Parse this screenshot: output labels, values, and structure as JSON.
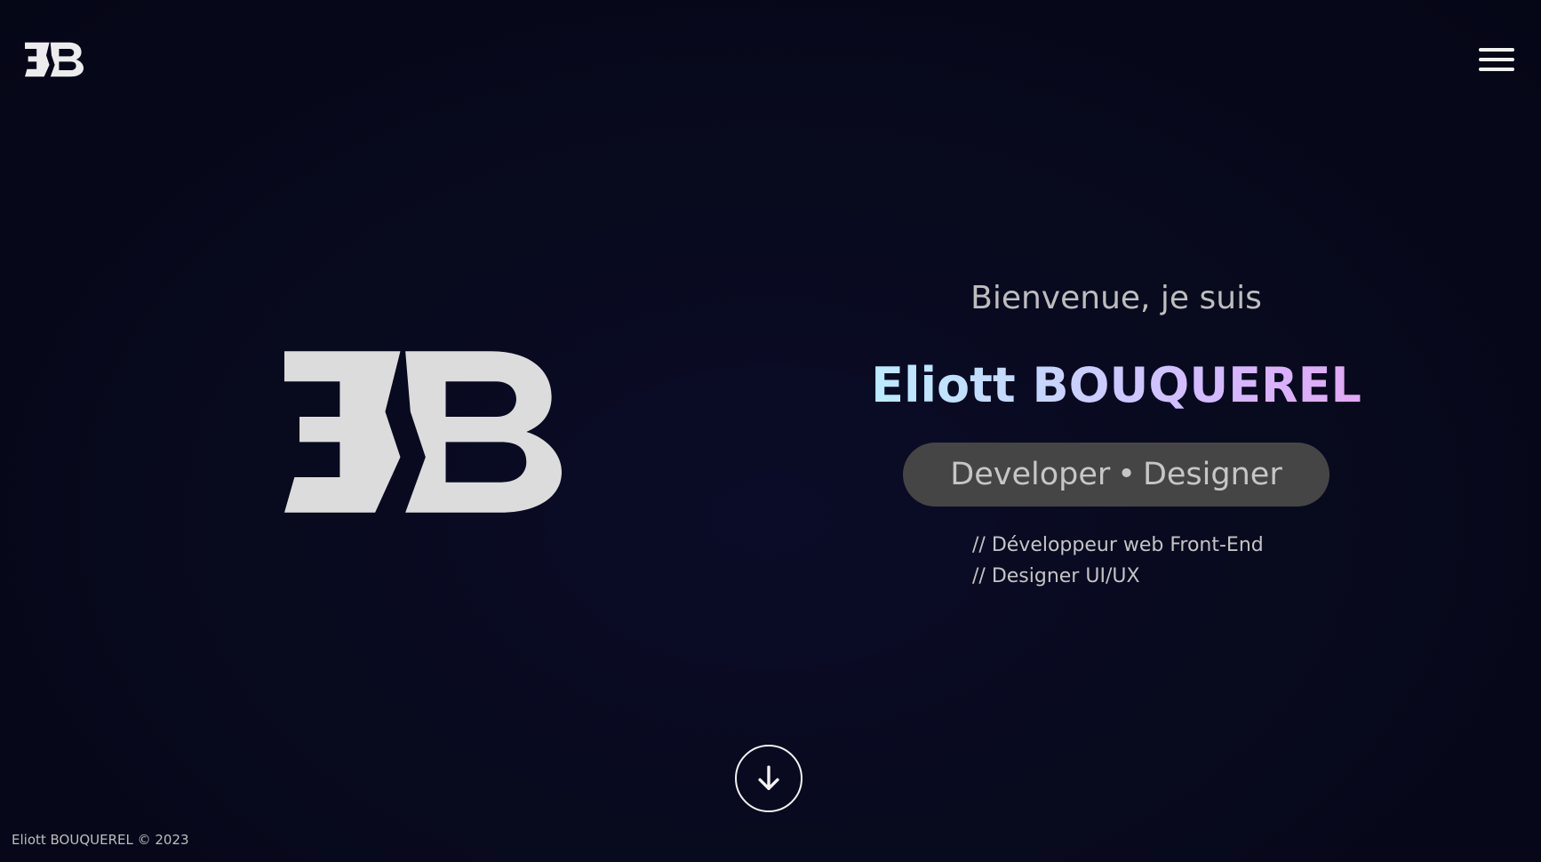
{
  "header": {
    "logo_icon": "eb-monogram-logo",
    "menu_icon": "hamburger-menu-icon"
  },
  "hero": {
    "logo_icon": "eb-monogram-logo-large",
    "greeting": "Bienvenue, je suis",
    "name": "Eliott BOUQUEREL",
    "roles": {
      "first": "Developer",
      "separator": "•",
      "second": "Designer"
    },
    "specialties": [
      "// Développeur web Front-End",
      "// Designer UI/UX"
    ],
    "scroll_icon": "arrow-down-icon"
  },
  "footer": {
    "copyright": "Eliott BOUQUEREL © 2023"
  },
  "colors": {
    "background": "#080a1e",
    "logo": "#dcdcdc",
    "pill": "#454545",
    "name_gradient": [
      "#b6f4ff",
      "#c5d8ff",
      "#d6b5ff",
      "#eaa0ee"
    ]
  }
}
